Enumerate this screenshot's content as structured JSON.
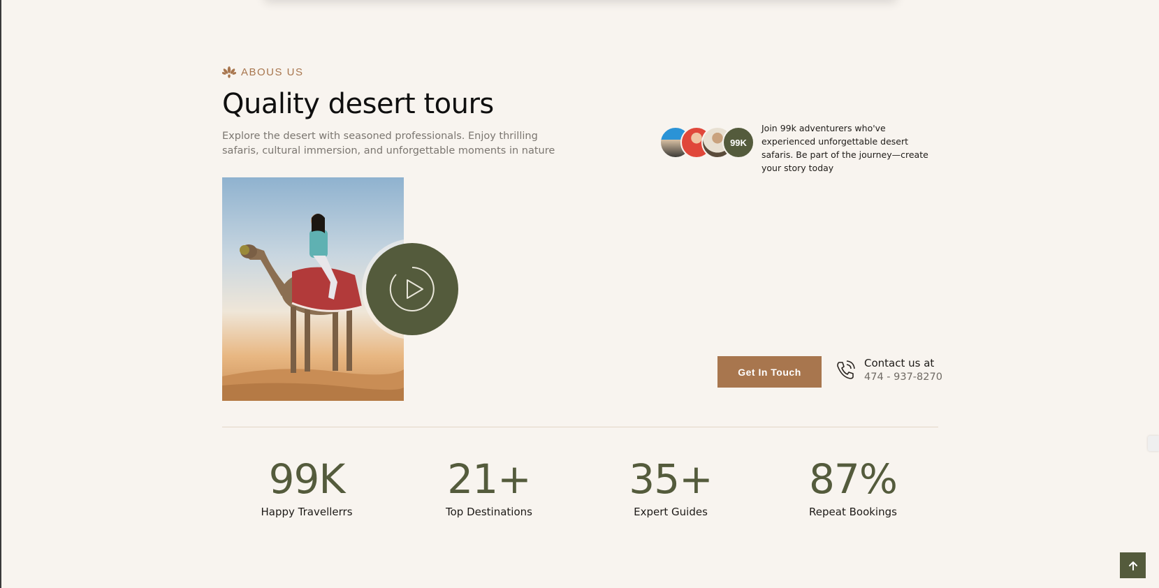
{
  "section": {
    "eyebrow": "ABOUS US",
    "heading": "Quality desert tours",
    "subtext": "Explore the desert with seasoned professionals. Enjoy thrilling safaris, cultural immersion, and unforgettable moments in nature"
  },
  "community": {
    "count_badge": "99K",
    "text": "Join 99k adventurers who've experienced unforgettable desert safaris. Be part of the journey—create your story today"
  },
  "cta": {
    "button_label": "Get In Touch",
    "contact_label": "Contact us at",
    "phone": "474 - 937-8270"
  },
  "stats": [
    {
      "value": "99K",
      "label": "Happy Travellerrs"
    },
    {
      "value": "21+",
      "label": "Top Destinations"
    },
    {
      "value": "35+",
      "label": "Expert Guides"
    },
    {
      "value": "87%",
      "label": "Repeat Bookings"
    }
  ],
  "colors": {
    "background": "#f8f4ef",
    "accent_brown": "#a8764e",
    "olive": "#545b3c"
  },
  "icons": [
    "lotus-icon",
    "play-icon",
    "phone-icon",
    "arrow-up-icon"
  ]
}
